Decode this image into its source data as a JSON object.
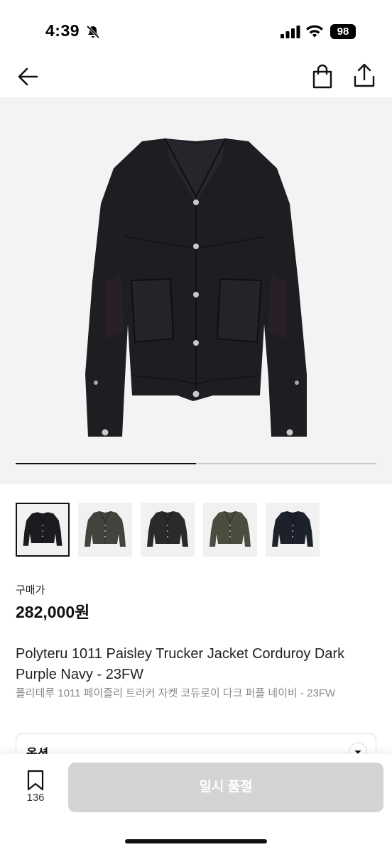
{
  "status_bar": {
    "time": "4:39",
    "battery": "98",
    "icons": [
      "bell-slash-icon",
      "signal-icon",
      "wifi-icon",
      "battery-icon"
    ]
  },
  "nav": {
    "icons": [
      "back-arrow-icon",
      "shopping-bag-icon",
      "share-icon"
    ]
  },
  "gallery": {
    "progress_fraction": 0.5,
    "thumbnail_count": 5,
    "selected_index": 0,
    "thumbnail_colors": [
      "#1c1b1f",
      "#44423d",
      "#2a2a2c",
      "#4a4e3f",
      "#1c212c"
    ]
  },
  "price": {
    "label": "구매가",
    "value": "282,000원"
  },
  "product": {
    "title_en": "Polyteru 1011 Paisley Trucker Jacket Corduroy Dark Purple Navy - 23FW",
    "title_ko": "폴리테루 1011 페이즐리 트러커 자켓 코듀로이 다크 퍼플 네이비 - 23FW"
  },
  "option": {
    "label": "옵션"
  },
  "bottom_bar": {
    "wish_count": "136",
    "buy_label": "일시 품절"
  },
  "colors": {
    "accent": "#111111",
    "disabled_button": "#d4d4d4",
    "subtle_text": "#8a8a8a",
    "image_background": "#f3f3f3"
  }
}
